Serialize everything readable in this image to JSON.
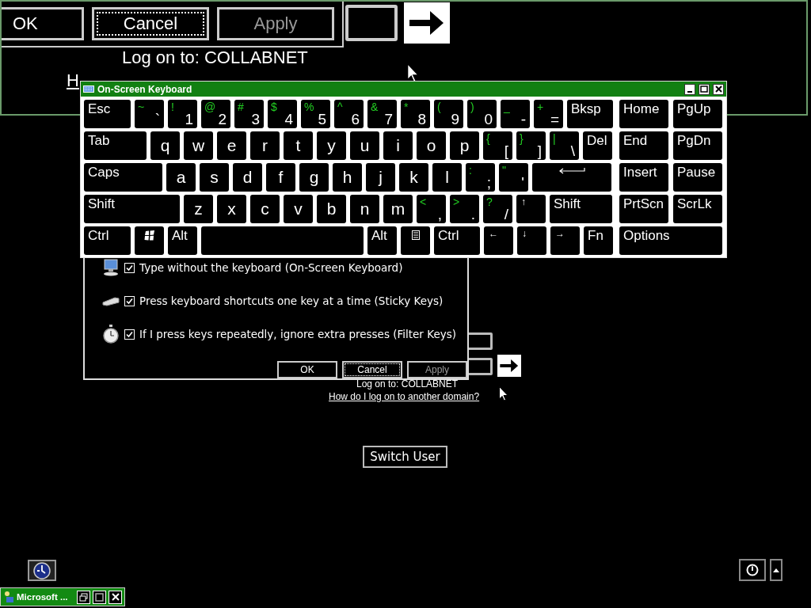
{
  "magnified_view": {
    "buttons": [
      {
        "label": "OK",
        "focused": false,
        "disabled": false
      },
      {
        "label": "Cancel",
        "focused": true,
        "disabled": false
      },
      {
        "label": "Apply",
        "focused": false,
        "disabled": true
      }
    ],
    "logon_to": "Log on to: COLLABNET",
    "domain_link": "H"
  },
  "on_screen_keyboard": {
    "title": "On-Screen Keyboard",
    "main_rows": [
      [
        {
          "kind": "text",
          "label": "Esc"
        },
        {
          "kind": "dual",
          "shift": "~",
          "label": "`"
        },
        {
          "kind": "dual",
          "shift": "!",
          "label": "1"
        },
        {
          "kind": "dual",
          "shift": "@",
          "label": "2"
        },
        {
          "kind": "dual",
          "shift": "#",
          "label": "3"
        },
        {
          "kind": "dual",
          "shift": "$",
          "label": "4"
        },
        {
          "kind": "dual",
          "shift": "%",
          "label": "5"
        },
        {
          "kind": "dual",
          "shift": "^",
          "label": "6"
        },
        {
          "kind": "dual",
          "shift": "&",
          "label": "7"
        },
        {
          "kind": "dual",
          "shift": "*",
          "label": "8"
        },
        {
          "kind": "dual",
          "shift": "(",
          "label": "9"
        },
        {
          "kind": "dual",
          "shift": ")",
          "label": "0"
        },
        {
          "kind": "dual",
          "shift": "_",
          "label": "-"
        },
        {
          "kind": "dual",
          "shift": "+",
          "label": "="
        },
        {
          "kind": "text",
          "label": "Bksp"
        }
      ],
      [
        {
          "kind": "text",
          "label": "Tab"
        },
        {
          "kind": "char",
          "label": "q"
        },
        {
          "kind": "char",
          "label": "w"
        },
        {
          "kind": "char",
          "label": "e"
        },
        {
          "kind": "char",
          "label": "r"
        },
        {
          "kind": "char",
          "label": "t"
        },
        {
          "kind": "char",
          "label": "y"
        },
        {
          "kind": "char",
          "label": "u"
        },
        {
          "kind": "char",
          "label": "i"
        },
        {
          "kind": "char",
          "label": "o"
        },
        {
          "kind": "char",
          "label": "p"
        },
        {
          "kind": "dual",
          "shift": "{",
          "label": "["
        },
        {
          "kind": "dual",
          "shift": "}",
          "label": "]"
        },
        {
          "kind": "dual",
          "shift": "|",
          "label": "\\"
        },
        {
          "kind": "text",
          "label": "Del"
        }
      ],
      [
        {
          "kind": "text",
          "label": "Caps"
        },
        {
          "kind": "char",
          "label": "a"
        },
        {
          "kind": "char",
          "label": "s"
        },
        {
          "kind": "char",
          "label": "d"
        },
        {
          "kind": "char",
          "label": "f"
        },
        {
          "kind": "char",
          "label": "g"
        },
        {
          "kind": "char",
          "label": "h"
        },
        {
          "kind": "char",
          "label": "j"
        },
        {
          "kind": "char",
          "label": "k"
        },
        {
          "kind": "char",
          "label": "l"
        },
        {
          "kind": "dual",
          "shift": ":",
          "label": ";"
        },
        {
          "kind": "dual",
          "shift": "\"",
          "label": "'"
        },
        {
          "kind": "enter"
        }
      ],
      [
        {
          "kind": "text",
          "label": "Shift"
        },
        {
          "kind": "char",
          "label": "z"
        },
        {
          "kind": "char",
          "label": "x"
        },
        {
          "kind": "char",
          "label": "c"
        },
        {
          "kind": "char",
          "label": "v"
        },
        {
          "kind": "char",
          "label": "b"
        },
        {
          "kind": "char",
          "label": "n"
        },
        {
          "kind": "char",
          "label": "m"
        },
        {
          "kind": "dual",
          "shift": "<",
          "label": ","
        },
        {
          "kind": "dual",
          "shift": ">",
          "label": "."
        },
        {
          "kind": "dual",
          "shift": "?",
          "label": "/"
        },
        {
          "kind": "small",
          "label": "↑"
        },
        {
          "kind": "text",
          "label": "Shift"
        }
      ],
      [
        {
          "kind": "text",
          "label": "Ctrl"
        },
        {
          "kind": "windows"
        },
        {
          "kind": "text",
          "label": "Alt"
        },
        {
          "kind": "space"
        },
        {
          "kind": "text",
          "label": "Alt"
        },
        {
          "kind": "menu"
        },
        {
          "kind": "text",
          "label": "Ctrl"
        },
        {
          "kind": "small",
          "label": "←"
        },
        {
          "kind": "small",
          "label": "↓"
        },
        {
          "kind": "small",
          "label": "→"
        },
        {
          "kind": "text",
          "label": "Fn"
        }
      ]
    ],
    "nav_rows": [
      [
        "Home",
        "PgUp"
      ],
      [
        "End",
        "PgDn"
      ],
      [
        "Insert",
        "Pause"
      ],
      [
        "PrtScn",
        "ScrLk"
      ],
      [
        "Options"
      ]
    ]
  },
  "ease_of_access_dialog": {
    "options": [
      {
        "label": "Type without the keyboard (On-Screen Keyboard)",
        "checked": true
      },
      {
        "label": "Press keyboard shortcuts one key at a time (Sticky Keys)",
        "checked": true
      },
      {
        "label": "If I press keys repeatedly, ignore extra presses (Filter Keys)",
        "checked": true
      }
    ],
    "buttons": [
      {
        "label": "OK",
        "focused": false,
        "disabled": false
      },
      {
        "label": "Cancel",
        "focused": true,
        "disabled": false
      },
      {
        "label": "Apply",
        "focused": false,
        "disabled": true
      }
    ]
  },
  "logon": {
    "logon_to": "Log on to: COLLABNET",
    "domain_link": "How do I log on to another domain?",
    "switch_user": "Switch User"
  },
  "taskbar": {
    "window_button": "Microsoft ..."
  }
}
